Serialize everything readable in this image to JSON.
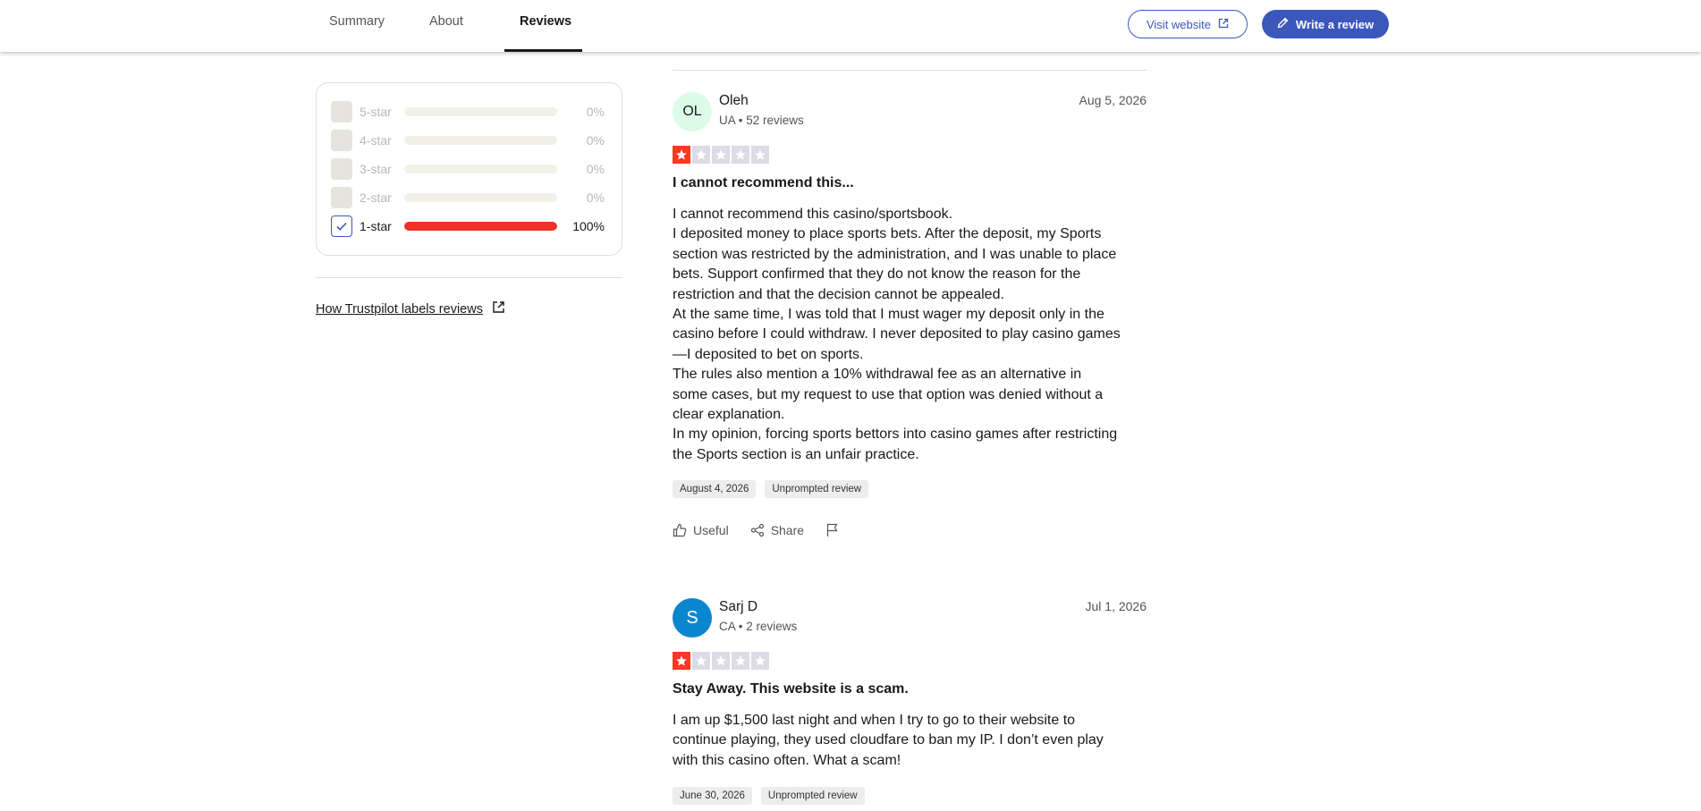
{
  "nav": {
    "tabs": [
      {
        "label": "Summary"
      },
      {
        "label": "About"
      },
      {
        "label": "Reviews"
      }
    ],
    "visit_label": "Visit website",
    "write_label": "Write a review",
    "accent": "#3c57bc"
  },
  "filter": {
    "rows": [
      {
        "label": "5-star",
        "percent_label": "0%",
        "fraction": 0,
        "checked": false
      },
      {
        "label": "4-star",
        "percent_label": "0%",
        "fraction": 0,
        "checked": false
      },
      {
        "label": "3-star",
        "percent_label": "0%",
        "fraction": 0,
        "checked": false
      },
      {
        "label": "2-star",
        "percent_label": "0%",
        "fraction": 0,
        "checked": false
      },
      {
        "label": "1-star",
        "percent_label": "100%",
        "fraction": 1,
        "checked": true
      }
    ],
    "bar_color": "#ee3124",
    "labels_link": "How Trustpilot labels reviews"
  },
  "reviews": [
    {
      "initials": "OL",
      "name": "Oleh",
      "meta": "UA • 52 reviews",
      "date": "Aug 5, 2026",
      "rating": 1,
      "title": "I cannot recommend this...",
      "body_lines": [
        "I cannot recommend this casino/sportsbook.",
        "I deposited money to place sports bets. After the deposit, my Sports",
        "section was restricted by the administration, and I was unable to place",
        "bets. Support confirmed that they do not know the reason for the",
        "restriction and that the decision cannot be appealed.",
        "At the same time, I was told that I must wager my deposit only in the",
        "casino before I could withdraw. I never deposited to play casino games",
        "—I deposited to bet on sports.",
        "The rules also mention a 10% withdrawal fee as an alternative in",
        "some cases, but my request to use that option was denied without a",
        "clear explanation.",
        "In my opinion, forcing sports bettors into casino games after restricting",
        "the Sports section is an unfair practice."
      ],
      "experience_date": "August 4, 2026",
      "tag": "Unprompted review",
      "useful_label": "Useful",
      "share_label": "Share"
    },
    {
      "initials": "S",
      "name": "Sarj D",
      "meta": "CA • 2 reviews",
      "date": "Jul 1, 2026",
      "rating": 1,
      "title": "Stay Away. This website is a scam.",
      "body_lines": [
        "I am up $1,500 last night and when I try to go to their website to",
        "continue playing, they used cloudfare to ban my IP. I don’t even play",
        "with this casino often. What a scam!"
      ],
      "experience_date": "June 30, 2026",
      "tag": "Unprompted review"
    }
  ]
}
